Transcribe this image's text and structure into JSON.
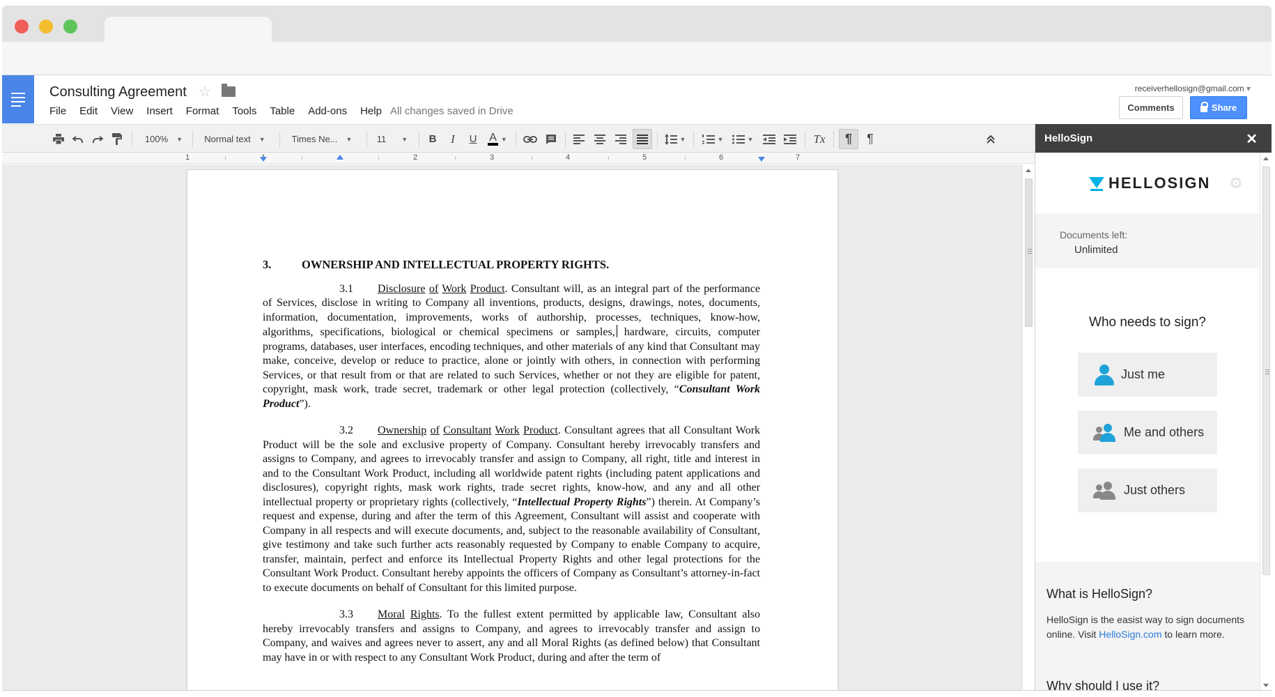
{
  "document": {
    "title": "Consulting Agreement",
    "save_status": "All changes saved in Drive"
  },
  "menu": [
    "File",
    "Edit",
    "View",
    "Insert",
    "Format",
    "Tools",
    "Table",
    "Add-ons",
    "Help"
  ],
  "account": {
    "email": "receiverhellosign@gmail.com",
    "comments_label": "Comments",
    "share_label": "Share"
  },
  "toolbar": {
    "zoom": "100%",
    "style": "Normal text",
    "font": "Times Ne...",
    "size": "11",
    "bold": "B",
    "italic": "I",
    "underline": "U",
    "text_color": "A",
    "clear_format": "Tx",
    "ltr": "¶",
    "rtl": "¶",
    "icons": [
      "print-icon",
      "undo-icon",
      "redo-icon",
      "paint-format-icon",
      "link-icon",
      "comment-icon",
      "align-left-icon",
      "align-center-icon",
      "align-right-icon",
      "justify-icon",
      "line-spacing-icon",
      "numbered-list-icon",
      "bulleted-list-icon",
      "decrease-indent-icon",
      "increase-indent-icon",
      "collapse-icon"
    ]
  },
  "ruler": [
    "1",
    "1",
    "2",
    "3",
    "4",
    "5",
    "6",
    "7"
  ],
  "body": {
    "heading_num": "3.",
    "heading_text": "OWNERSHIP AND INTELLECTUAL PROPERTY RIGHTS.",
    "p31": {
      "num": "3.1",
      "title_words": [
        "Disclosure",
        "of",
        "Work",
        "Product"
      ],
      "text_a": ".  Consultant will, as an integral part of the performance of Services, disclose in writing to Company all inventions, products, designs, drawings, notes, documents, information, documentation, improvements, works of authorship, processes, techniques, know-how, algorithms, specifications, biological or chemical specimens or samples,",
      "text_b": " hardware, circuits, computer programs, databases, user interfaces, encoding techniques, and other materials of any kind that Consultant may make, conceive, develop or reduce to practice, alone or jointly with others, in connection with performing Services, or that result from or that are related to such Services, whether or not they are eligible for patent, copyright, mask work, trade secret, trademark or other legal protection (collectively, “",
      "term": "Consultant Work Product",
      "text_c": "”)."
    },
    "p32": {
      "num": "3.2",
      "title_words": [
        "Ownership",
        "of",
        "Consultant",
        "Work",
        "Product"
      ],
      "text_a": ".  Consultant agrees that all Consultant Work Product will be the sole and exclusive property of Company.  Consultant hereby irrevocably transfers and assigns to Company, and agrees to irrevocably transfer and assign to Company, all right, title and interest in and to the Consultant Work Product, including all worldwide patent rights (including patent applications and disclosures), copyright rights, mask work rights, trade secret rights, know-how, and any and all other intellectual property or proprietary rights (collectively, “",
      "term": "Intellectual Property Rights",
      "text_b": "”) therein.  At Company’s request and expense, during and after the term of this Agreement, Consultant will assist and cooperate with Company in all respects and will execute documents, and, subject to the reasonable availability of Consultant, give testimony and take such further acts reasonably requested by Company to enable Company to acquire, transfer, maintain, perfect and enforce its Intellectual Property Rights and other legal protections for the Consultant Work Product. Consultant hereby appoints the officers of Company as Consultant’s attorney-in-fact to execute documents on behalf of Consultant for this limited purpose."
    },
    "p33": {
      "num": "3.3",
      "title_words": [
        "Moral",
        "Rights"
      ],
      "text_a": ".  To the fullest extent permitted by applicable law, Consultant also hereby irrevocably transfers and assigns to Company, and agrees to irrevocably transfer and assign to Company, and waives and agrees never to assert, any and all Moral Rights (as defined below) that Consultant may have in or with respect to any Consultant Work Product, during and after the term of"
    }
  },
  "hellosign": {
    "panel_title": "HelloSign",
    "brand": "HELLOSIGN",
    "docs_left_label": "Documents left:",
    "docs_left_value": "Unlimited",
    "who_label": "Who needs to sign?",
    "options": [
      "Just me",
      "Me and others",
      "Just others"
    ],
    "what_title": "What is HelloSign?",
    "what_text": "HelloSign is the easist way to sign documents online. Visit ",
    "what_link": "HelloSign.com",
    "what_text_end": " to learn more.",
    "why_title": "Why should I use it?"
  }
}
